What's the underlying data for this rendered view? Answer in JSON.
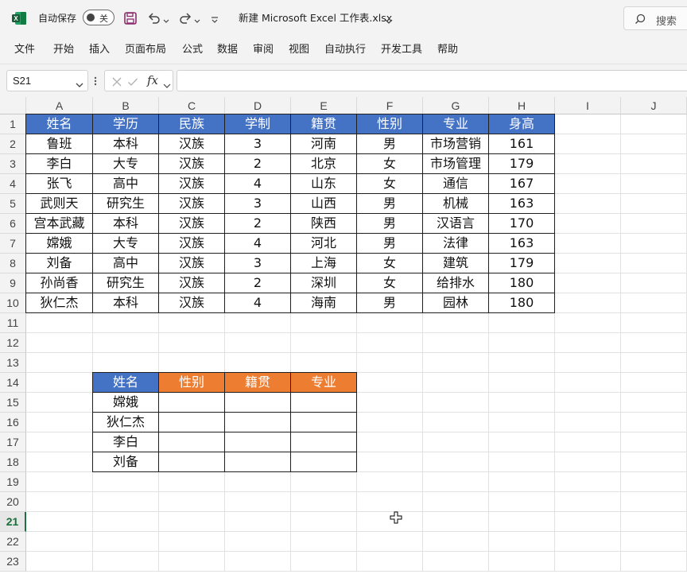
{
  "titlebar": {
    "autosave_label": "自动保存",
    "autosave_state": "关",
    "filename": "新建 Microsoft Excel 工作表.xlsx",
    "search_label": "搜索"
  },
  "ribbon_tabs": [
    "文件",
    "开始",
    "插入",
    "页面布局",
    "公式",
    "数据",
    "审阅",
    "视图",
    "自动执行",
    "开发工具",
    "帮助"
  ],
  "formula_bar": {
    "name_box": "S21",
    "fx": "fx",
    "formula": ""
  },
  "columns": [
    "A",
    "B",
    "C",
    "D",
    "E",
    "F",
    "G",
    "H",
    "I",
    "J"
  ],
  "rows": [
    "1",
    "2",
    "3",
    "4",
    "5",
    "6",
    "7",
    "8",
    "9",
    "10",
    "11",
    "12",
    "13",
    "14",
    "15",
    "16",
    "17",
    "18",
    "19",
    "20",
    "21",
    "22",
    "23"
  ],
  "active_row": "21",
  "table1": {
    "headers": [
      "姓名",
      "学历",
      "民族",
      "学制",
      "籍贯",
      "性别",
      "专业",
      "身高"
    ],
    "rows": [
      [
        "鲁班",
        "本科",
        "汉族",
        "3",
        "河南",
        "男",
        "市场营销",
        "161"
      ],
      [
        "李白",
        "大专",
        "汉族",
        "2",
        "北京",
        "女",
        "市场管理",
        "179"
      ],
      [
        "张飞",
        "高中",
        "汉族",
        "4",
        "山东",
        "女",
        "通信",
        "167"
      ],
      [
        "武则天",
        "研究生",
        "汉族",
        "3",
        "山西",
        "男",
        "机械",
        "163"
      ],
      [
        "宫本武藏",
        "本科",
        "汉族",
        "2",
        "陕西",
        "男",
        "汉语言",
        "170"
      ],
      [
        "嫦娥",
        "大专",
        "汉族",
        "4",
        "河北",
        "男",
        "法律",
        "163"
      ],
      [
        "刘备",
        "高中",
        "汉族",
        "3",
        "上海",
        "女",
        "建筑",
        "179"
      ],
      [
        "孙尚香",
        "研究生",
        "汉族",
        "2",
        "深圳",
        "女",
        "给排水",
        "180"
      ],
      [
        "狄仁杰",
        "本科",
        "汉族",
        "4",
        "海南",
        "男",
        "园林",
        "180"
      ]
    ]
  },
  "table2": {
    "headers": [
      "姓名",
      "性别",
      "籍贯",
      "专业"
    ],
    "rows": [
      [
        "嫦娥",
        "",
        "",
        ""
      ],
      [
        "狄仁杰",
        "",
        "",
        ""
      ],
      [
        "李白",
        "",
        "",
        ""
      ],
      [
        "刘备",
        "",
        "",
        ""
      ]
    ]
  },
  "colors": {
    "header_blue": "#4472c4",
    "header_orange": "#ed7d31",
    "excel_green": "#1e7145"
  }
}
